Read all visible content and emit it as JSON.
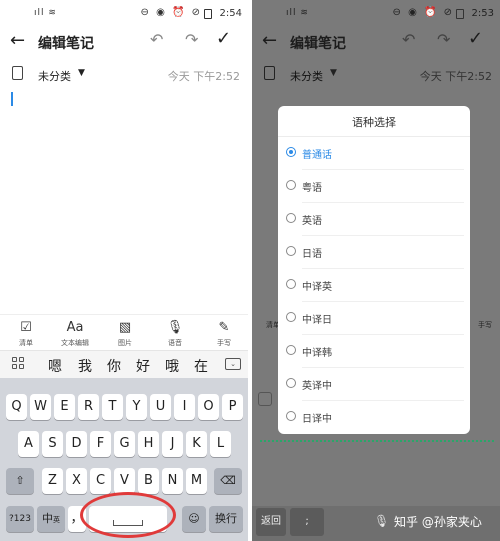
{
  "left": {
    "status": {
      "signal": "ıll ≋",
      "icons": "⊖ ◉ ⏰ ⊘",
      "time": "2:54"
    },
    "title": "编辑笔记",
    "category": "未分类",
    "date": "今天 下午2:52",
    "toolbar": [
      {
        "icon": "☑",
        "label": "清单"
      },
      {
        "icon": "Aa",
        "label": "文本编辑"
      },
      {
        "icon": "▧",
        "label": "图片"
      },
      {
        "icon": "🎙",
        "label": "语音"
      },
      {
        "icon": "✎",
        "label": "手写"
      }
    ],
    "candidates": [
      "嗯",
      "我",
      "你",
      "好",
      "哦",
      "在"
    ],
    "keyboard": {
      "row1": [
        "Q",
        "W",
        "E",
        "R",
        "T",
        "Y",
        "U",
        "I",
        "O",
        "P"
      ],
      "row2": [
        "A",
        "S",
        "D",
        "F",
        "G",
        "H",
        "J",
        "K",
        "L"
      ],
      "row3": [
        "Z",
        "X",
        "C",
        "V",
        "B",
        "N",
        "M"
      ],
      "shift": "⇧",
      "delete": "⌫",
      "num": "?123",
      "lang": "中",
      "lang_sub": "英",
      "comma": "，",
      "emoji": "☺",
      "enter": "换行"
    }
  },
  "right": {
    "status": {
      "signal": "ıll ≋",
      "icons": "⊖ ◉ ⏰ ⊘",
      "time": "2:53"
    },
    "title": "编辑笔记",
    "category": "未分类",
    "date": "今天 下午2:52",
    "dialog": {
      "title": "语种选择",
      "options": [
        "普通话",
        "粤语",
        "英语",
        "日语",
        "中译英",
        "中译日",
        "中译韩",
        "英译中",
        "日译中"
      ],
      "selected_index": 0
    },
    "toolbar_bits": [
      "清单",
      "图片",
      "手写"
    ],
    "bottom": {
      "back": "返回",
      "semicolon": ";",
      "watermark": "知乎 @孙家夹心"
    }
  },
  "colors": {
    "accent": "#2b8ae6",
    "highlight": "#e03a3a",
    "dots": "#2aa66a"
  }
}
